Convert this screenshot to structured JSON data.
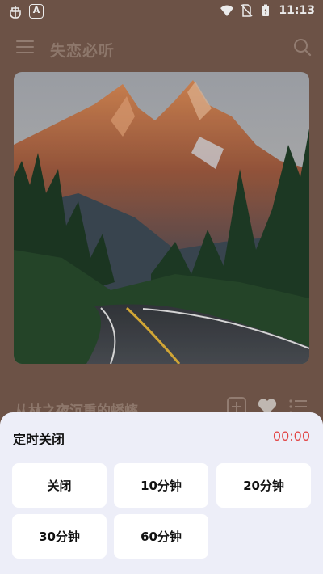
{
  "status_bar": {
    "time": "11:13",
    "app_badge": "A",
    "icons": [
      "bug-icon",
      "app-a-icon",
      "wifi-icon",
      "no-sim-icon",
      "battery-charging-icon"
    ]
  },
  "app_bar": {
    "title": "失恋必听",
    "menu_icon": "menu-icon",
    "search_icon": "search-icon"
  },
  "song": {
    "title": "从林之夜沉重的蟋蟀",
    "actions": [
      "add-to-playlist-icon",
      "favorite-heart-icon",
      "playlist-icon"
    ]
  },
  "sleep_timer_sheet": {
    "title": "定时关闭",
    "remaining": "00:00",
    "remaining_color": "#e24343",
    "options": [
      "关闭",
      "10分钟",
      "20分钟",
      "30分钟",
      "60分钟"
    ]
  }
}
